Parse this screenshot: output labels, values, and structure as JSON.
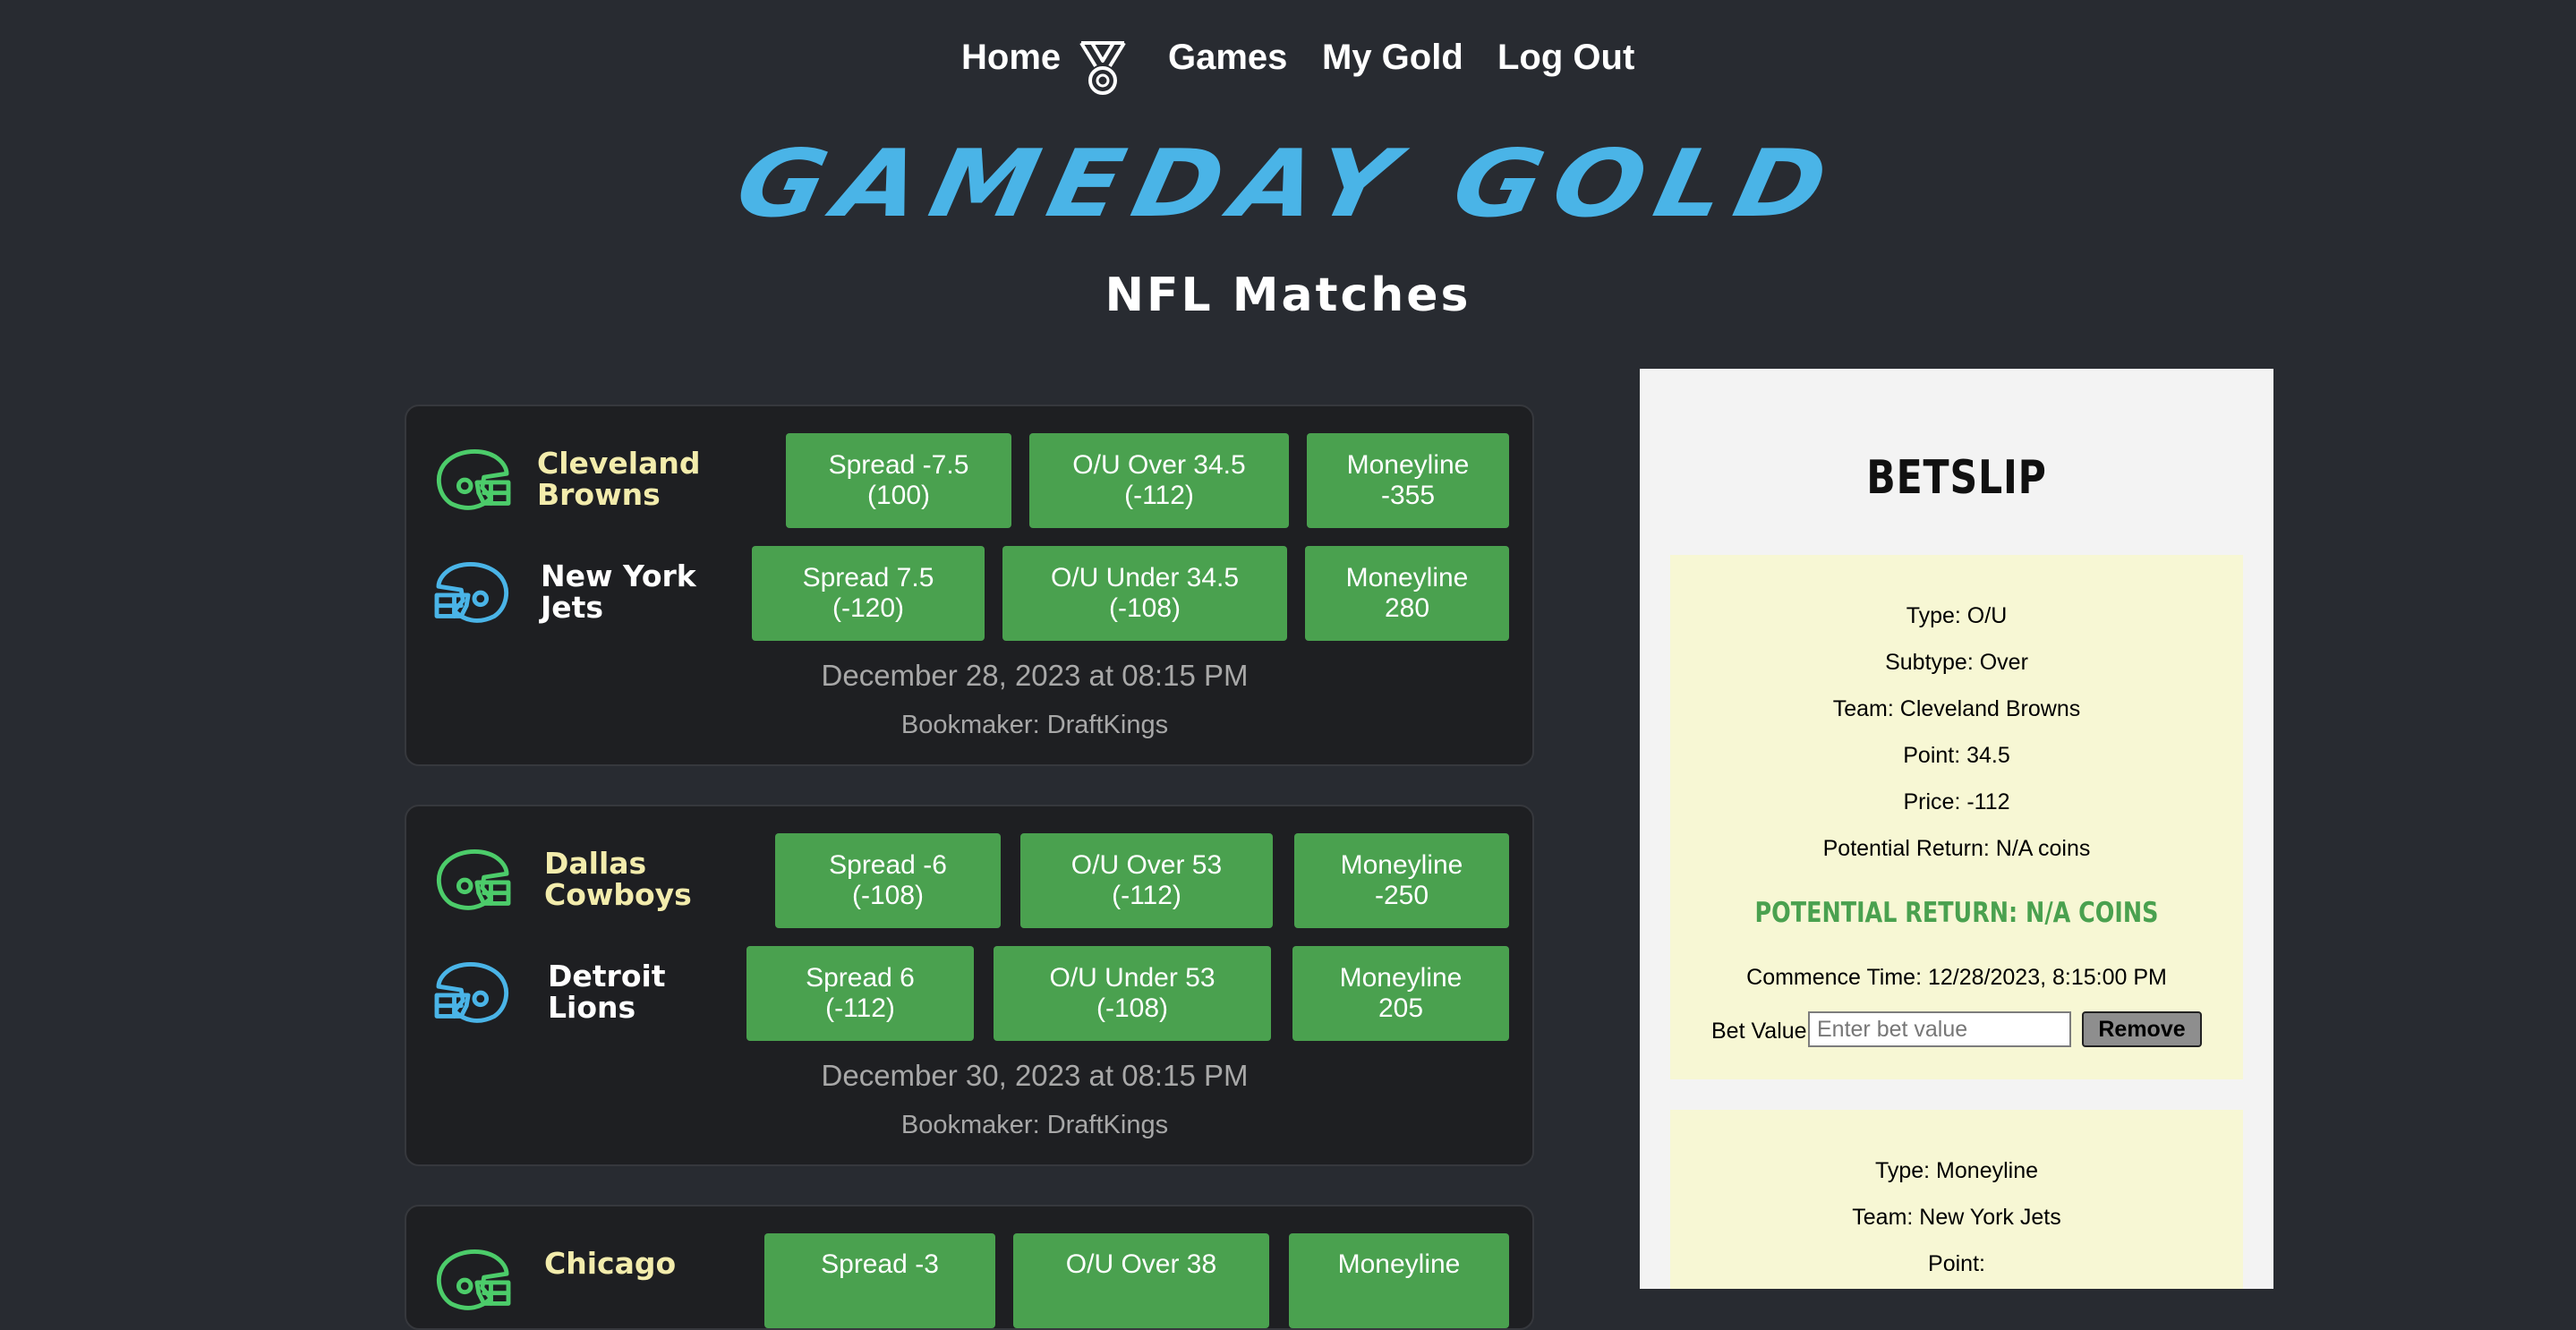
{
  "nav": {
    "home": "Home",
    "games": "Games",
    "my_gold": "My Gold",
    "logout": "Log Out"
  },
  "logo_text": "GAMEDAY GOLD",
  "page_title": "NFL Matches",
  "colors": {
    "background": "#282b31",
    "card": "#1e1f22",
    "button_green": "#4aa14f",
    "logo_blue": "#4ab4e7",
    "home_team": "#f3ecac",
    "helmet_green": "#4ccc6a",
    "helmet_blue": "#4ab4e7",
    "betslip_bg": "#f3f3f3",
    "slip_card_bg": "#f7f7d4"
  },
  "matches": [
    {
      "home_team": {
        "line1": "Cleveland",
        "line2": "Browns",
        "icon": "football-helmet-icon"
      },
      "away_team": {
        "line1": "New York",
        "line2": "Jets",
        "icon": "football-helmet-icon"
      },
      "home_bets": {
        "spread": {
          "line1": "Spread -7.5",
          "line2": "(100)"
        },
        "ou": {
          "line1": "O/U Over 34.5",
          "line2": "(-112)"
        },
        "moneyline": {
          "line1": "Moneyline",
          "line2": "-355"
        }
      },
      "away_bets": {
        "spread": {
          "line1": "Spread 7.5",
          "line2": "(-120)"
        },
        "ou": {
          "line1": "O/U Under 34.5",
          "line2": "(-108)"
        },
        "moneyline": {
          "line1": "Moneyline",
          "line2": "280"
        }
      },
      "date": "December 28, 2023 at 08:15 PM",
      "bookmaker": "Bookmaker: DraftKings"
    },
    {
      "home_team": {
        "line1": "Dallas",
        "line2": "Cowboys",
        "icon": "football-helmet-icon"
      },
      "away_team": {
        "line1": "Detroit",
        "line2": "Lions",
        "icon": "football-helmet-icon"
      },
      "home_bets": {
        "spread": {
          "line1": "Spread -6",
          "line2": "(-108)"
        },
        "ou": {
          "line1": "O/U Over 53",
          "line2": "(-112)"
        },
        "moneyline": {
          "line1": "Moneyline",
          "line2": "-250"
        }
      },
      "away_bets": {
        "spread": {
          "line1": "Spread 6",
          "line2": "(-112)"
        },
        "ou": {
          "line1": "O/U Under 53",
          "line2": "(-108)"
        },
        "moneyline": {
          "line1": "Moneyline",
          "line2": "205"
        }
      },
      "date": "December 30, 2023 at 08:15 PM",
      "bookmaker": "Bookmaker: DraftKings"
    },
    {
      "home_team": {
        "line1": "Chicago",
        "line2": "",
        "icon": "football-helmet-icon"
      },
      "home_bets": {
        "spread": {
          "line1": "Spread -3",
          "line2": ""
        },
        "ou": {
          "line1": "O/U Over 38",
          "line2": ""
        },
        "moneyline": {
          "line1": "Moneyline",
          "line2": ""
        }
      }
    }
  ],
  "betslip": {
    "title": "BETSLIP",
    "items": [
      {
        "type": "Type: O/U",
        "subtype": "Subtype: Over",
        "team": "Team: Cleveland Browns",
        "point": "Point: 34.5",
        "price": "Price: -112",
        "potential_return": "Potential Return: N/A coins",
        "potential_return_highlight": "POTENTIAL RETURN: N/A COINS",
        "commence_time": "Commence Time: 12/28/2023, 8:15:00 PM",
        "bet_value_label": "Bet Value:",
        "bet_value_placeholder": "Enter bet value",
        "remove_label": "Remove"
      },
      {
        "type": "Type: Moneyline",
        "team": "Team: New York Jets",
        "point": "Point:"
      }
    ]
  }
}
